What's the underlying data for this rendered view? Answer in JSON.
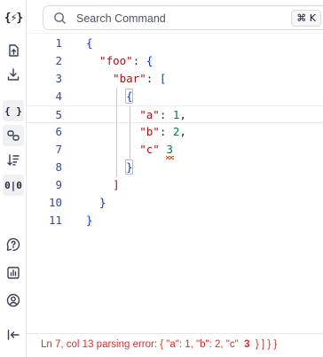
{
  "app": {
    "logo_text": "{⚡}"
  },
  "sidebar": {
    "items": [
      {
        "name": "upload",
        "icon": "upload-icon"
      },
      {
        "name": "download",
        "icon": "download-icon"
      },
      {
        "name": "format-json",
        "icon": "braces-icon",
        "label": "{ }"
      },
      {
        "name": "compare",
        "icon": "compare-icon"
      },
      {
        "name": "sort",
        "icon": "sort-icon"
      },
      {
        "name": "split-view",
        "icon": "split-view-icon",
        "label": "0|0"
      },
      {
        "name": "help",
        "icon": "help-icon"
      },
      {
        "name": "stats",
        "icon": "chart-icon"
      },
      {
        "name": "account",
        "icon": "user-icon"
      },
      {
        "name": "collapse",
        "icon": "collapse-icon"
      }
    ]
  },
  "search": {
    "placeholder": "Search Command",
    "shortcut": "⌘ K"
  },
  "editor": {
    "line_numbers": [
      "1",
      "2",
      "3",
      "4",
      "5",
      "6",
      "7",
      "8",
      "9",
      "10",
      "11"
    ],
    "active_line": 5,
    "lines": [
      [
        {
          "t": "{",
          "c": "brace"
        }
      ],
      [
        {
          "t": "\"foo\"",
          "c": "key"
        },
        {
          "t": ": ",
          "c": "punct"
        },
        {
          "t": "{",
          "c": "brace"
        }
      ],
      [
        {
          "t": "\"bar\"",
          "c": "key"
        },
        {
          "t": ": ",
          "c": "punct"
        },
        {
          "t": "[",
          "c": "brace"
        }
      ],
      [
        {
          "t": "{",
          "c": "brace"
        }
      ],
      [
        {
          "t": "\"a\"",
          "c": "key"
        },
        {
          "t": ": ",
          "c": "punct"
        },
        {
          "t": "1",
          "c": "num"
        },
        {
          "t": ",",
          "c": "punct"
        }
      ],
      [
        {
          "t": "\"b\"",
          "c": "key"
        },
        {
          "t": ": ",
          "c": "punct"
        },
        {
          "t": "2",
          "c": "num"
        },
        {
          "t": ",",
          "c": "punct"
        }
      ],
      [
        {
          "t": "\"c\"",
          "c": "key"
        },
        {
          "t": " ",
          "c": "punct"
        },
        {
          "t": "3",
          "c": "num"
        }
      ],
      [
        {
          "t": "}",
          "c": "brace"
        }
      ],
      [
        {
          "t": "]",
          "c": "key"
        }
      ],
      [
        {
          "t": "}",
          "c": "brace"
        }
      ],
      [
        {
          "t": "}",
          "c": "brace"
        }
      ]
    ]
  },
  "status": {
    "position": "Ln 7, col 13",
    "error_label": "parsing error:",
    "error_snippet_pre": "{ \"a\": 1, \"b\": 2, \"c\"",
    "error_token": "3",
    "error_snippet_post": "} ] } }"
  },
  "colors": {
    "brace": "#0b38c9",
    "key": "#a31515",
    "number": "#0b7a3e",
    "error": "#d0312d"
  }
}
